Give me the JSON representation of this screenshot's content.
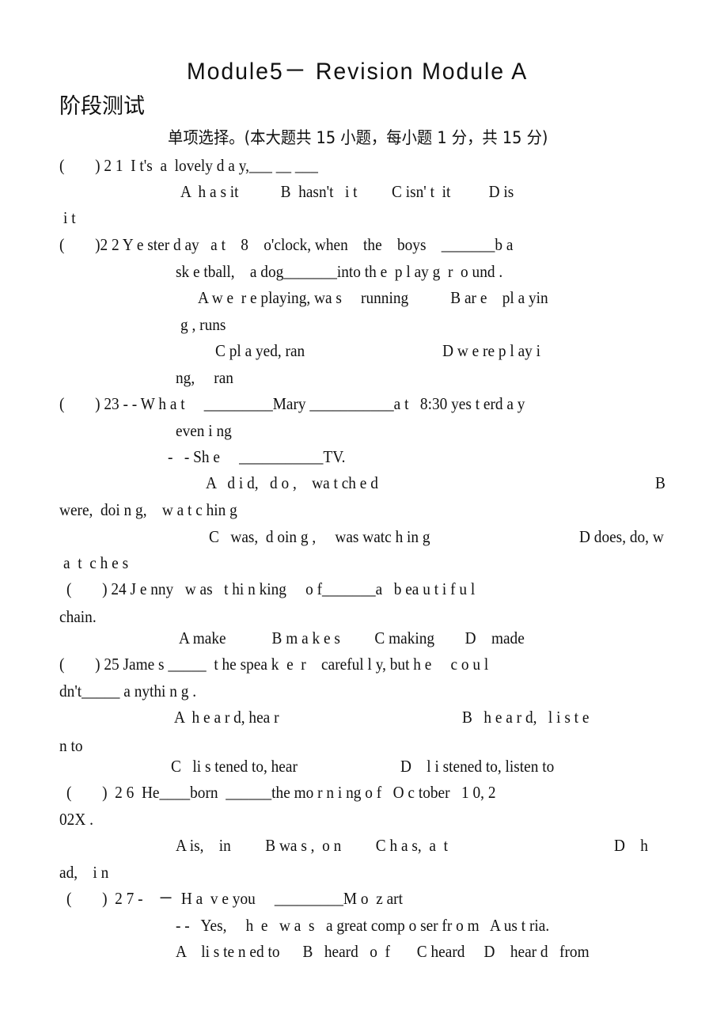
{
  "document": {
    "title": "Module5－ Revision Module A",
    "subtitle": "阶段测试",
    "section_instruction": "单项选择。(本大题共 15 小题，每小题 1 分，共 15 分)",
    "lines": [
      "(        ) 2 1  I t's  a  lovely d a y,___ __ ___",
      "A  h a s it           B  hasn't   i t         C isn' t  it          D is",
      "i t",
      "(        )2 2 Y e ster d ay   a t    8    o'clock, when    the    boys    _______b a",
      "sk e tball,    a dog_______into th e  p l ay g  r  o und .",
      "A w e  r e playing, wa s     running           B ar e    pl a yin",
      "g , runs",
      "C pl a yed, ran                                    D w e re p l ay i",
      "ng,     ran",
      "(        ) 23 - - W h a t     _________Mary ___________a t   8:30 yes t erd a y",
      "even i ng",
      "-   - Sh e     ___________TV.",
      "A   d i d,   d o ,    wa t ch e d",
      "B",
      "were,  doi n g,    w a t c hin g",
      "C   was,  d oin g ,     was watc h in g",
      "D does, do, w",
      "a  t  c h e s",
      "(        ) 24 J e nny   w as   t hi n king     o f_______a   b ea u t i f u l",
      "chain.",
      "A make            B m a k e s         C making        D    made",
      "(        ) 25 Jame s _____  t he spea k  e  r    careful l y, but h e     c o u l",
      "dn't_____ a nythi n g .",
      "A  h e a r d, hea r",
      "B   h e a r d,   l i s t e",
      "n to",
      "C   li s tened to, hear",
      "D    l i stened to, listen to",
      "(        )  2 6  He____born  ______the mo r n i ng o f   O c tober   1 0, 2",
      "02X .",
      "A is,    in         B wa s ,  o n         C h a s,  a  t",
      "D    h",
      "ad,    i n",
      "(        )  2 7 -    －  H a  v e you     _________M o  z art",
      "- -   Yes,     h  e   w a  s   a great comp o ser fr o m   A us t ria.",
      "A    li s te n ed to      B   heard   o  f       C heard     D    hear d   from"
    ]
  }
}
